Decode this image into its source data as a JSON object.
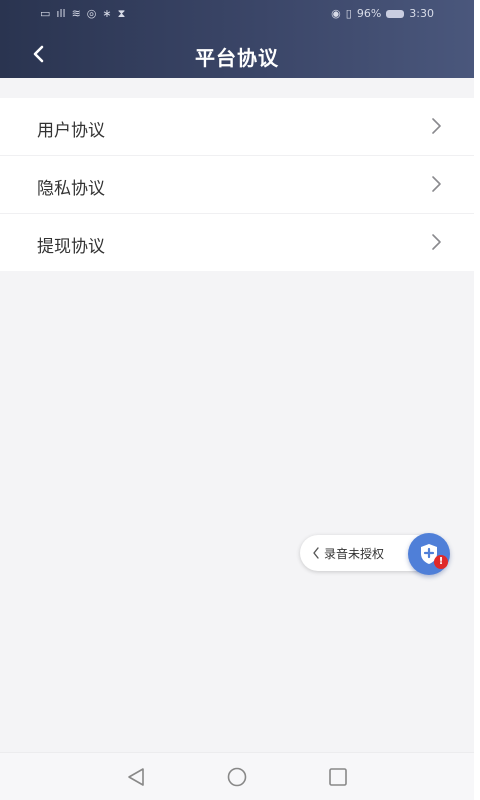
{
  "status_bar": {
    "left_icons": [
      "hd-icon",
      "signal-icon",
      "wifi-icon",
      "eye-icon",
      "bluetooth-icon",
      "hourglass-icon"
    ],
    "battery_percent": "96%",
    "time": "3:30"
  },
  "header": {
    "title": "平台协议",
    "background_color": "#3b4668"
  },
  "list": {
    "items": [
      {
        "label": "用户协议"
      },
      {
        "label": "隐私协议"
      },
      {
        "label": "提现协议"
      }
    ]
  },
  "recording_widget": {
    "label": "录音未授权",
    "badge": "!",
    "accent_color": "#4f7fd8"
  },
  "system_nav": {
    "buttons": [
      "back-triangle-icon",
      "home-circle-icon",
      "recents-square-icon"
    ]
  }
}
